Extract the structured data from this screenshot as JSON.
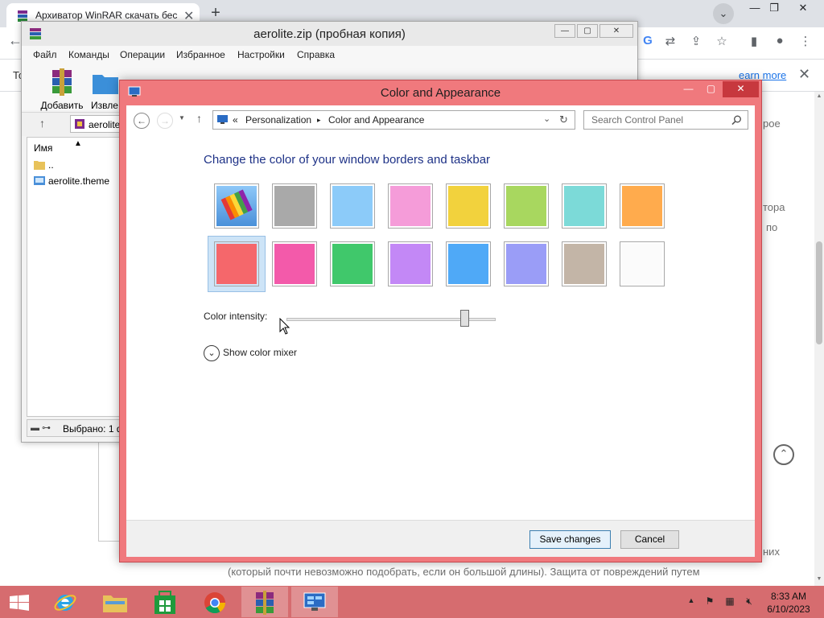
{
  "browser": {
    "tab_title": "Архиватор WinRAR скачать бес",
    "tab_close": "✕",
    "new_tab": "+",
    "tab_search": "⌄",
    "window_min": "—",
    "window_max": "❐",
    "window_close": "✕",
    "infobar_left": "То",
    "learn_more": "earn more",
    "infobar_close": "✕",
    "bg_fragments": [
      "рое",
      "тора",
      "по",
      "них"
    ],
    "bottom_line": "(который почти невозможно подобрать, если он большой длины). Защита от повреждений путем",
    "scroll_up": "⌃"
  },
  "winrar": {
    "title": "aerolite.zip (пробная копия)",
    "menu": [
      "Файл",
      "Команды",
      "Операции",
      "Избранное",
      "Настройки",
      "Справка"
    ],
    "tools": [
      "Добавить",
      "Извле"
    ],
    "address": "aerolite",
    "column_name": "Имя",
    "files": [
      "..",
      "aerolite.theme"
    ],
    "status": "Выбрано: 1 ф",
    "btn_min": "—",
    "btn_max": "▢",
    "btn_close": "✕"
  },
  "cp": {
    "title": "Color and Appearance",
    "btn_min": "—",
    "btn_max": "▢",
    "btn_close": "✕",
    "breadcrumb": {
      "prefix": "«",
      "items": [
        "Personalization",
        "Color and Appearance"
      ],
      "separator": "▸"
    },
    "search_placeholder": "Search Control Panel",
    "heading": "Change the color of your window borders and taskbar",
    "swatches_row1": [
      "auto",
      "#a9a9a9",
      "#8ccbf9",
      "#f59cd9",
      "#f2d23d",
      "#a8d75f",
      "#7cdad8",
      "#ffab4d"
    ],
    "swatches_row2": [
      "#f5676b",
      "#f35aaa",
      "#40c86b",
      "#c388f6",
      "#4fa9f7",
      "#9a9df7",
      "#c3b5a7",
      "#fbfbfb"
    ],
    "selected_swatch": "#f5676b",
    "intensity_label": "Color intensity:",
    "intensity_value": 0.85,
    "mixer_label": "Show color mixer",
    "save_label": "Save changes",
    "cancel_label": "Cancel"
  },
  "taskbar": {
    "color": "#d66c6f",
    "time": "8:33 AM",
    "date": "6/10/2023",
    "apps": [
      "start-icon",
      "internet-explorer-icon",
      "file-explorer-icon",
      "store-icon",
      "chrome-icon",
      "winrar-icon",
      "control-panel-icon"
    ]
  }
}
